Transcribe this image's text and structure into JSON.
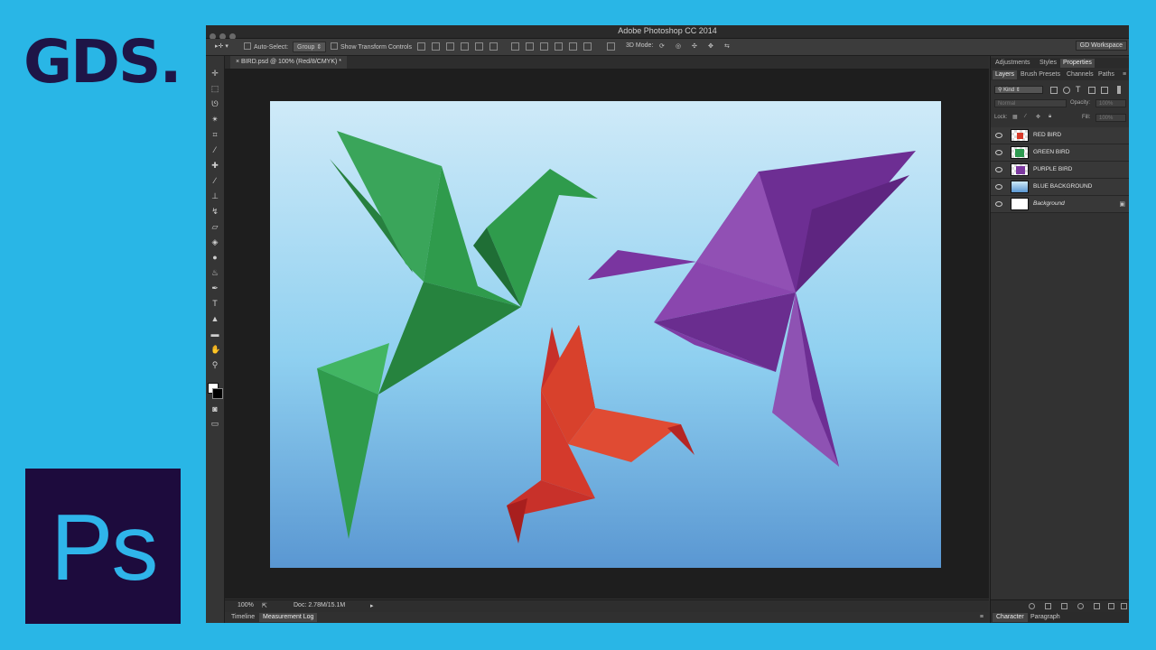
{
  "branding": {
    "gds_logo": "GDS.",
    "ps_logo": "Ps"
  },
  "window": {
    "title": "Adobe Photoshop CC 2014"
  },
  "options_bar": {
    "auto_select_label": "Auto-Select:",
    "auto_select_value": "Group",
    "show_transform_label": "Show Transform Controls",
    "mode_3d_label": "3D Mode:",
    "workspace_label": "GD Workspace"
  },
  "document": {
    "tab_label": "BIRD.psd @ 100% (Red/8/CMYK) *"
  },
  "status_bar": {
    "zoom": "100%",
    "doc_size": "Doc: 2.78M/15.1M"
  },
  "bottom_tabs": [
    "Timeline",
    "Measurement Log"
  ],
  "panels": {
    "top_tabs": [
      "Adjustments",
      "Styles",
      "Properties"
    ],
    "layer_tabs": [
      "Layers",
      "Brush Presets",
      "Channels",
      "Paths"
    ],
    "filter_kind": "Kind",
    "blend_mode": "Normal",
    "opacity_label": "Opacity:",
    "opacity_value": "100%",
    "lock_label": "Lock:",
    "fill_label": "Fill:",
    "fill_value": "100%",
    "layers": [
      {
        "name": "RED BIRD"
      },
      {
        "name": "GREEN BIRD"
      },
      {
        "name": "PURPLE BIRD"
      },
      {
        "name": "BLUE BACKGROUND"
      },
      {
        "name": "Background",
        "locked": true
      }
    ],
    "bottom_tabs": [
      "Character",
      "Paragraph"
    ]
  },
  "colors": {
    "page_bg": "#29b6e6",
    "brand_navy": "#1e1547",
    "ps_dark": "#1d0b3d",
    "ps_blue": "#2fb5ea",
    "bird_green": "#2e9a50",
    "bird_purple": "#7d3aa0",
    "bird_red": "#d63a2a"
  }
}
